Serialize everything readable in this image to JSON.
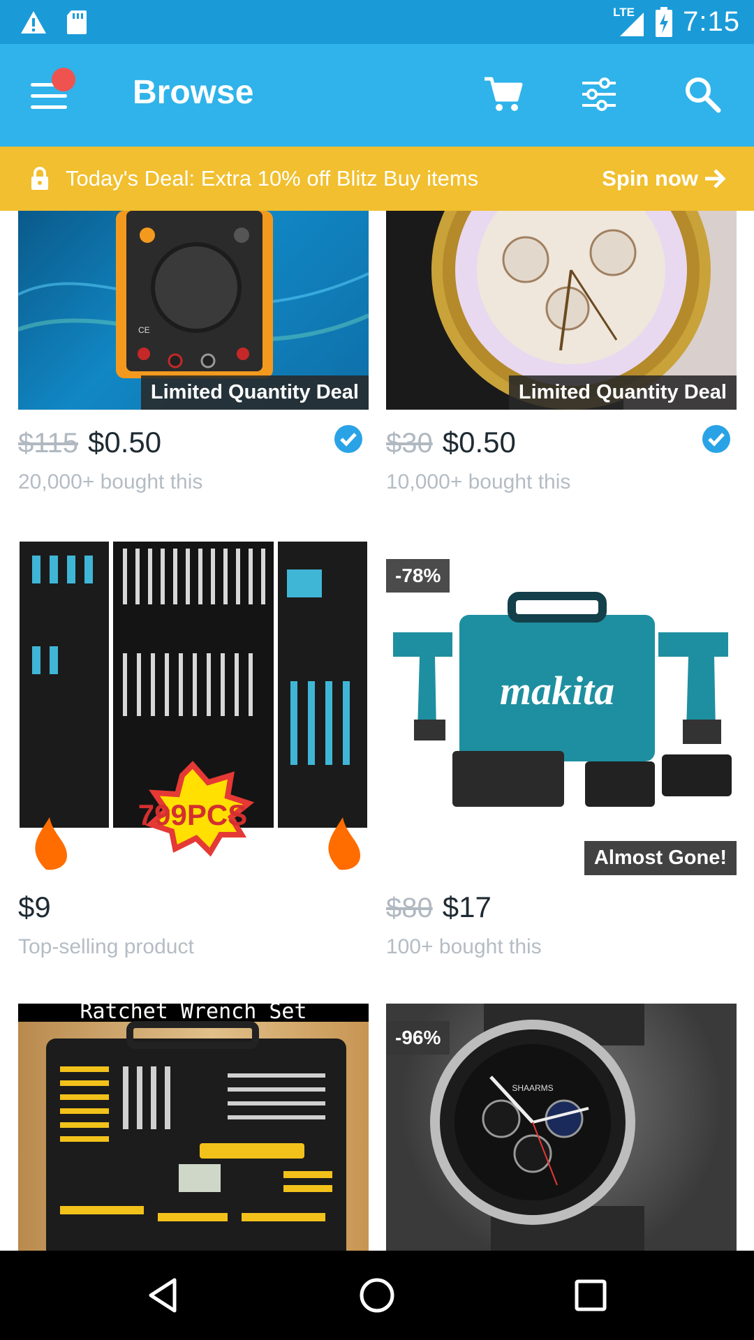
{
  "status_bar": {
    "time": "7:15",
    "network": "LTE",
    "icons": [
      "warning-icon",
      "sd-card-icon",
      "signal-icon",
      "battery-charging-icon"
    ]
  },
  "app_bar": {
    "title": "Browse",
    "notification_dot_color": "#ef5350",
    "icons": [
      "menu-icon",
      "cart-icon",
      "filter-icon",
      "search-icon"
    ]
  },
  "deal_banner": {
    "text": "Today's Deal: Extra 10% off Blitz Buy items",
    "cta": "Spin now",
    "color": "#f1bf2f",
    "icons": [
      "lock-icon",
      "arrow-right-icon"
    ]
  },
  "products": [
    {
      "image": "multimeter",
      "label": "Limited Quantity Deal",
      "old_price": "$115",
      "price": "$0.50",
      "subtitle": "20,000+ bought this",
      "verified": true
    },
    {
      "image": "gold-watch",
      "label": "Limited Quantity Deal",
      "old_price": "$30",
      "price": "$0.50",
      "subtitle": "10,000+ bought this",
      "verified": true
    },
    {
      "image": "tool-set",
      "image_text": "799PCS",
      "price": "$9",
      "subtitle": "Top-selling product"
    },
    {
      "image": "makita-drill-kit",
      "image_text": "makita",
      "discount": "-78%",
      "label": "Almost Gone!",
      "old_price": "$80",
      "price": "$17",
      "subtitle": "100+ bought this"
    },
    {
      "image": "wrench-set",
      "image_text": "Ratchet Wrench Set"
    },
    {
      "image": "black-watch",
      "image_text": "SHAARMS",
      "discount": "-96%"
    }
  ],
  "nav_bar": {
    "icons": [
      "back-icon",
      "home-icon",
      "recents-icon"
    ]
  },
  "colors": {
    "status_bar": "#1a9bd8",
    "app_bar": "#2fb3ea",
    "verified_badge": "#2aa3e6"
  }
}
